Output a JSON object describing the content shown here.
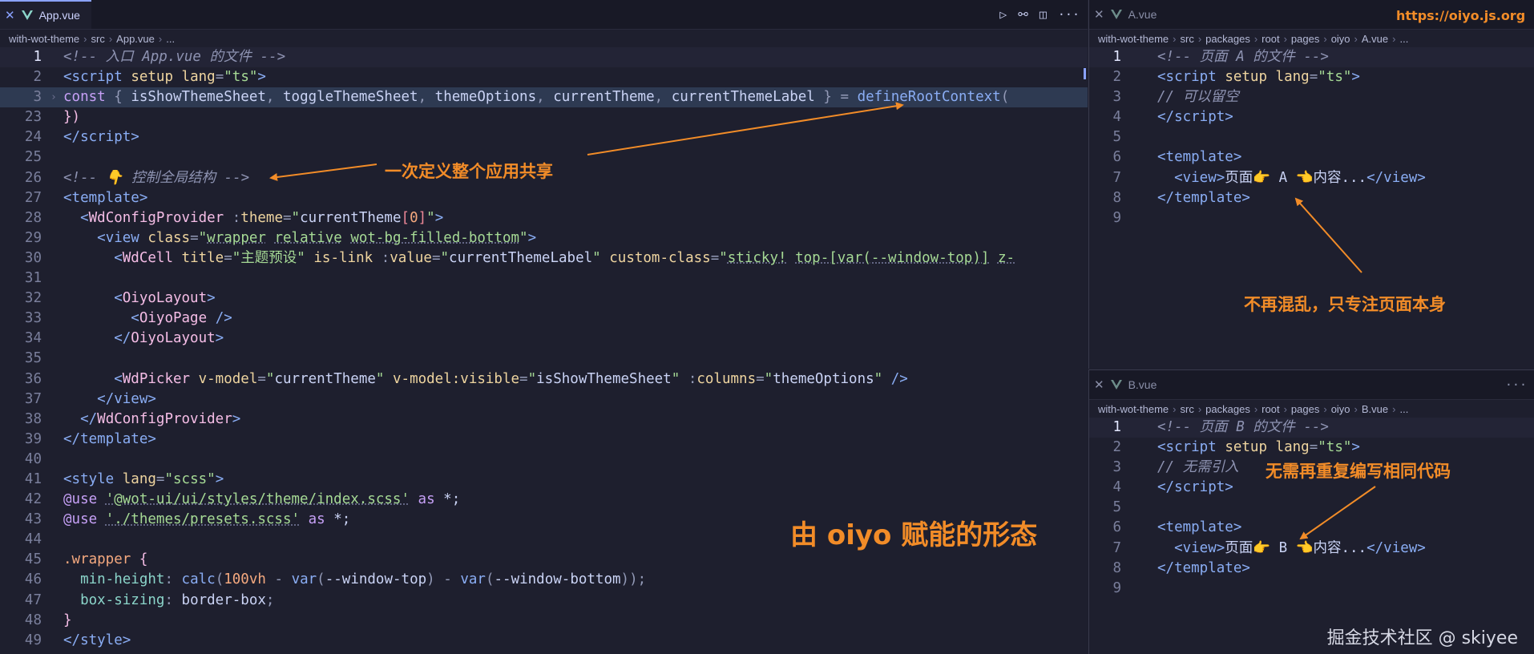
{
  "left_editor": {
    "tab": "App.vue",
    "breadcrumb": [
      "with-wot-theme",
      "src",
      "App.vue",
      "..."
    ],
    "lines": [
      {
        "n": "1",
        "current": true,
        "html": "<span class='c-com'>&lt;!-- 入口 App.vue 的文件 --&gt;</span>"
      },
      {
        "n": "2",
        "html": "<span class='c-tag'>&lt;script</span> <span class='c-attr'>setup</span> <span class='c-attr'>lang</span><span class='c-pn'>=</span><span class='c-str'>\"ts\"</span><span class='c-tag'>&gt;</span>"
      },
      {
        "n": "3",
        "fold": true,
        "hl": true,
        "html": "<span class='c-kw'>const</span> <span class='c-pn'>{</span> <span class='c-var'>isShowThemeSheet</span><span class='c-pn'>,</span> <span class='c-var'>toggleThemeSheet</span><span class='c-pn'>,</span> <span class='c-var'>themeOptions</span><span class='c-pn'>,</span> <span class='c-var'>currentTheme</span><span class='c-pn'>,</span> <span class='c-var'>currentThemeLabel</span> <span class='c-pn'>}</span> <span class='c-pn'>=</span> <span class='c-fn'>defineRootContext</span><span class='c-pn'>(</span>"
      },
      {
        "n": "23",
        "html": "<span class='c-mag'>})</span>"
      },
      {
        "n": "24",
        "html": "<span class='c-tag'>&lt;/script&gt;</span>"
      },
      {
        "n": "25",
        "html": ""
      },
      {
        "n": "26",
        "html": "<span class='c-com'>&lt;!-- 👇 控制全局结构 --&gt;</span>"
      },
      {
        "n": "27",
        "html": "<span class='c-tag'>&lt;template&gt;</span>"
      },
      {
        "n": "28",
        "html": "  <span class='c-tag'>&lt;</span><span class='c-cmp'>WdConfigProvider</span> <span class='c-pn'>:</span><span class='c-attr'>theme</span><span class='c-pn'>=</span><span class='c-str'>\"</span><span class='c-var'>currentTheme</span><span class='c-red'>[</span><span class='c-num'>0</span><span class='c-red'>]</span><span class='c-str'>\"</span><span class='c-tag'>&gt;</span>"
      },
      {
        "n": "29",
        "html": "    <span class='c-tag'>&lt;view</span> <span class='c-attr'>class</span><span class='c-pn'>=</span><span class='c-str'>\"<span class='u'>wrapper</span> <span class='u'>relative</span> <span class='u'>wot-bg-filled-bottom</span>\"</span><span class='c-tag'>&gt;</span>"
      },
      {
        "n": "30",
        "html": "      <span class='c-tag'>&lt;</span><span class='c-cmp'>WdCell</span> <span class='c-attr'>title</span><span class='c-pn'>=</span><span class='c-str'>\"主题预设\"</span> <span class='c-attr'>is-link</span> <span class='c-pn'>:</span><span class='c-attr'>value</span><span class='c-pn'>=</span><span class='c-str'>\"</span><span class='c-var'>currentThemeLabel</span><span class='c-str'>\"</span> <span class='c-attr'>custom-class</span><span class='c-pn'>=</span><span class='c-str'>\"<span class='u'>sticky!</span> <span class='u'>top-[var(--window-top)]</span> <span class='u'>z-</span></span>"
      },
      {
        "n": "31",
        "html": ""
      },
      {
        "n": "32",
        "html": "      <span class='c-tag'>&lt;</span><span class='c-cmp'>OiyoLayout</span><span class='c-tag'>&gt;</span>"
      },
      {
        "n": "33",
        "html": "        <span class='c-tag'>&lt;</span><span class='c-cmp'>OiyoPage</span> <span class='c-tag'>/&gt;</span>"
      },
      {
        "n": "34",
        "html": "      <span class='c-tag'>&lt;/</span><span class='c-cmp'>OiyoLayout</span><span class='c-tag'>&gt;</span>"
      },
      {
        "n": "35",
        "html": ""
      },
      {
        "n": "36",
        "html": "      <span class='c-tag'>&lt;</span><span class='c-cmp'>WdPicker</span> <span class='c-attr'>v-model</span><span class='c-pn'>=</span><span class='c-str'>\"</span><span class='c-var'>currentTheme</span><span class='c-str'>\"</span> <span class='c-attr'>v-model:visible</span><span class='c-pn'>=</span><span class='c-str'>\"</span><span class='c-var'>isShowThemeSheet</span><span class='c-str'>\"</span> <span class='c-pn'>:</span><span class='c-attr'>columns</span><span class='c-pn'>=</span><span class='c-str'>\"</span><span class='c-var'>themeOptions</span><span class='c-str'>\"</span> <span class='c-tag'>/&gt;</span>"
      },
      {
        "n": "37",
        "html": "    <span class='c-tag'>&lt;/view&gt;</span>"
      },
      {
        "n": "38",
        "html": "  <span class='c-tag'>&lt;/</span><span class='c-cmp'>WdConfigProvider</span><span class='c-tag'>&gt;</span>"
      },
      {
        "n": "39",
        "html": "<span class='c-tag'>&lt;/template&gt;</span>"
      },
      {
        "n": "40",
        "html": ""
      },
      {
        "n": "41",
        "html": "<span class='c-tag'>&lt;style</span> <span class='c-attr'>lang</span><span class='c-pn'>=</span><span class='c-str'>\"scss\"</span><span class='c-tag'>&gt;</span>"
      },
      {
        "n": "42",
        "html": "<span class='c-kw'>@use</span> <span class='c-str u'>'@wot-ui/ui/styles/theme/index.scss'</span> <span class='c-kw'>as</span> <span class='c-var'>*;</span>"
      },
      {
        "n": "43",
        "html": "<span class='c-kw'>@use</span> <span class='c-str u'>'./themes/presets.scss'</span> <span class='c-kw'>as</span> <span class='c-var'>*;</span>"
      },
      {
        "n": "44",
        "html": ""
      },
      {
        "n": "45",
        "html": "<span class='c-num'>.wrapper</span> <span class='c-mag'>{</span>"
      },
      {
        "n": "46",
        "html": "  <span class='c-prop'>min-height</span><span class='c-pn'>:</span> <span class='c-fn'>calc</span><span class='c-pn'>(</span><span class='c-num'>100vh</span> <span class='c-pn'>-</span> <span class='c-fn'>var</span><span class='c-pn'>(</span><span class='c-var'>--window-top</span><span class='c-pn'>)</span> <span class='c-pn'>-</span> <span class='c-fn'>var</span><span class='c-pn'>(</span><span class='c-var'>--window-bottom</span><span class='c-pn'>));</span>"
      },
      {
        "n": "47",
        "html": "  <span class='c-prop'>box-sizing</span><span class='c-pn'>:</span> <span class='c-var'>border-box</span><span class='c-pn'>;</span>"
      },
      {
        "n": "48",
        "html": "<span class='c-mag'>}</span>"
      },
      {
        "n": "49",
        "html": "<span class='c-tag'>&lt;/style&gt;</span>"
      }
    ]
  },
  "right_top_editor": {
    "tab": "A.vue",
    "breadcrumb": [
      "with-wot-theme",
      "src",
      "packages",
      "root",
      "pages",
      "oiyo",
      "A.vue",
      "..."
    ],
    "lines": [
      {
        "n": "1",
        "current": true,
        "html": "<span class='c-com'>&lt;!-- 页面 A 的文件 --&gt;</span>"
      },
      {
        "n": "2",
        "html": "<span class='c-tag'>&lt;script</span> <span class='c-attr'>setup</span> <span class='c-attr'>lang</span><span class='c-pn'>=</span><span class='c-str'>\"ts\"</span><span class='c-tag'>&gt;</span>"
      },
      {
        "n": "3",
        "html": "<span class='c-com'>// 可以留空</span>"
      },
      {
        "n": "4",
        "html": "<span class='c-tag'>&lt;/script&gt;</span>"
      },
      {
        "n": "5",
        "html": ""
      },
      {
        "n": "6",
        "html": "<span class='c-tag'>&lt;template&gt;</span>"
      },
      {
        "n": "7",
        "html": "  <span class='c-tag'>&lt;view&gt;</span><span class='c-var'>页面👉 A 👈内容...</span><span class='c-tag'>&lt;/view&gt;</span>"
      },
      {
        "n": "8",
        "html": "<span class='c-tag'>&lt;/template&gt;</span>"
      },
      {
        "n": "9",
        "html": ""
      }
    ]
  },
  "right_bottom_editor": {
    "tab": "B.vue",
    "breadcrumb": [
      "with-wot-theme",
      "src",
      "packages",
      "root",
      "pages",
      "oiyo",
      "B.vue",
      "..."
    ],
    "lines": [
      {
        "n": "1",
        "current": true,
        "html": "<span class='c-com'>&lt;!-- 页面 B 的文件 --&gt;</span>"
      },
      {
        "n": "2",
        "html": "<span class='c-tag'>&lt;script</span> <span class='c-attr'>setup</span> <span class='c-attr'>lang</span><span class='c-pn'>=</span><span class='c-str'>\"ts\"</span><span class='c-tag'>&gt;</span>"
      },
      {
        "n": "3",
        "html": "<span class='c-com'>// 无需引入</span>"
      },
      {
        "n": "4",
        "html": "<span class='c-tag'>&lt;/script&gt;</span>"
      },
      {
        "n": "5",
        "html": ""
      },
      {
        "n": "6",
        "html": "<span class='c-tag'>&lt;template&gt;</span>"
      },
      {
        "n": "7",
        "html": "  <span class='c-tag'>&lt;view&gt;</span><span class='c-var'>页面👉 B 👈内容...</span><span class='c-tag'>&lt;/view&gt;</span>"
      },
      {
        "n": "8",
        "html": "<span class='c-tag'>&lt;/template&gt;</span>"
      },
      {
        "n": "9",
        "html": ""
      }
    ]
  },
  "annotations": {
    "shared_context": "一次定义整个应用共享",
    "oiyo_power": "由 oiyo 赋能的形态",
    "focus_page": "不再混乱，只专注页面本身",
    "no_repeat": "无需再重复编写相同代码",
    "url": "https://oiyo.js.org"
  },
  "watermark": "掘金技术社区 @ skiyee",
  "colors": {
    "background": "#1e1f2e",
    "accent": "#f28c28",
    "tab_bar": "#181926"
  }
}
